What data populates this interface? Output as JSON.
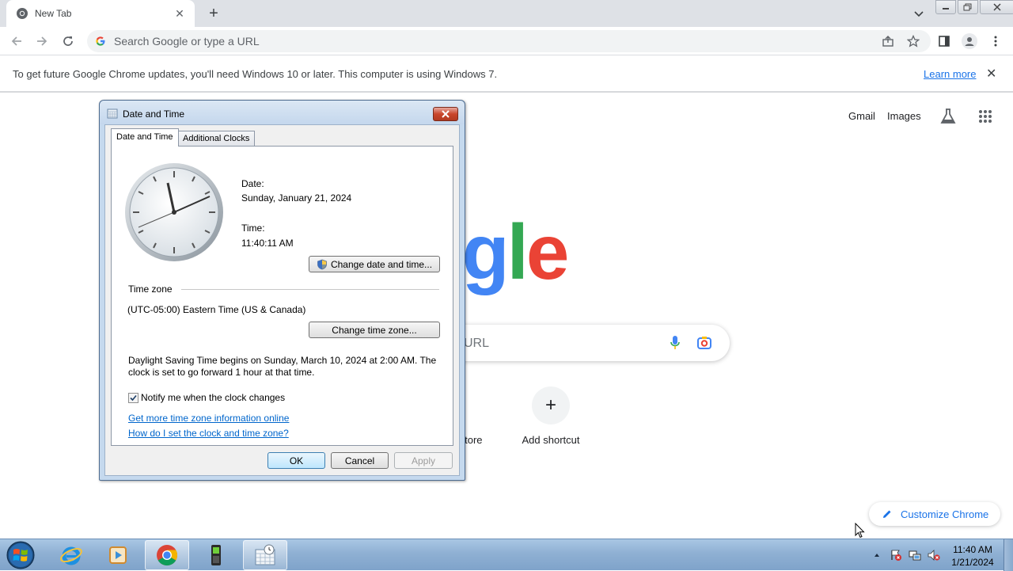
{
  "browser": {
    "tab": {
      "title": "New Tab",
      "close": "✕"
    },
    "new_tab": "+",
    "omnibox": {
      "placeholder": "Search Google or type a URL"
    },
    "infobar": {
      "message": "To get future Google Chrome updates, you'll need Windows 10 or later. This computer is using Windows 7.",
      "link": "Learn more",
      "close": "✕"
    }
  },
  "ntp": {
    "links": [
      "Gmail",
      "Images"
    ],
    "logo_visible": "oogle",
    "search_placeholder_visible": "URL",
    "shortcuts": [
      {
        "label": "Store"
      },
      {
        "label": "Add shortcut",
        "icon": "+"
      }
    ],
    "customize": "Customize Chrome"
  },
  "dialog": {
    "title": "Date and Time",
    "tabs": [
      "Date and Time",
      "Additional Clocks"
    ],
    "date_label": "Date:",
    "date_value": "Sunday, January 21, 2024",
    "time_label": "Time:",
    "time_value": "11:40:11 AM",
    "change_datetime_button": "Change date and time...",
    "timezone_label": "Time zone",
    "timezone_value": "(UTC-05:00) Eastern Time (US & Canada)",
    "change_timezone_button": "Change time zone...",
    "dst_line1": "Daylight Saving Time begins on Sunday, March 10, 2024 at 2:00 AM. The",
    "dst_line2": "clock is set to go forward 1 hour at that time.",
    "notify_label": "Notify me when the clock changes",
    "notify_checked": true,
    "link1": "Get more time zone information online",
    "link2": "How do I set the clock and time zone?",
    "ok": "OK",
    "cancel": "Cancel",
    "apply": "Apply"
  },
  "taskbar": {
    "items": [
      "start-orb",
      "internet-explorer",
      "media-player",
      "google-chrome",
      "device-app",
      "date-time-control-panel"
    ],
    "active_item": "google-chrome",
    "clock_time": "11:40 AM",
    "clock_date": "1/21/2024"
  },
  "colors": {
    "google_blue": "#4285f4",
    "google_red": "#ea4335",
    "google_yellow": "#fbbc05",
    "google_green": "#34a853",
    "link_blue": "#1a73e8"
  }
}
